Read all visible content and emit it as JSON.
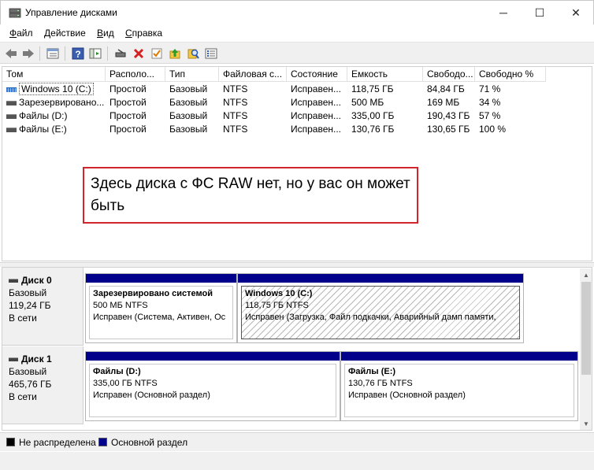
{
  "window": {
    "title": "Управление дисками",
    "minimize_glyph": "─",
    "maximize_glyph": "☐",
    "close_glyph": "✕"
  },
  "menu": {
    "items": [
      {
        "label": "Файл",
        "underline": "Ф",
        "rest": "айл"
      },
      {
        "label": "Действие",
        "underline": "Д",
        "rest": "ействие"
      },
      {
        "label": "Вид",
        "underline": "В",
        "rest": "ид"
      },
      {
        "label": "Справка",
        "underline": "С",
        "rest": "правка"
      }
    ]
  },
  "toolbar": {
    "buttons": [
      "back-arrow-icon",
      "forward-arrow-icon",
      "properties-list-icon",
      "help-icon",
      "console-tree-icon",
      "connect-drive-icon",
      "delete-icon",
      "check-icon",
      "up-folder-icon",
      "search-icon",
      "properties-icon"
    ]
  },
  "volumes": {
    "columns": [
      "Том",
      "Располо...",
      "Тип",
      "Файловая с...",
      "Состояние",
      "Емкость",
      "Свободо...",
      "Свободно %"
    ],
    "rows": [
      {
        "name": "Windows 10 (C:)",
        "layout": "Простой",
        "type": "Базовый",
        "fs": "NTFS",
        "status": "Исправен...",
        "capacity": "118,75 ГБ",
        "free": "84,84 ГБ",
        "free_pct": "71 %",
        "selected": true
      },
      {
        "name": "Зарезервировано...",
        "layout": "Простой",
        "type": "Базовый",
        "fs": "NTFS",
        "status": "Исправен...",
        "capacity": "500 МБ",
        "free": "169 МБ",
        "free_pct": "34 %",
        "selected": false
      },
      {
        "name": "Файлы (D:)",
        "layout": "Простой",
        "type": "Базовый",
        "fs": "NTFS",
        "status": "Исправен...",
        "capacity": "335,00 ГБ",
        "free": "190,43 ГБ",
        "free_pct": "57 %",
        "selected": false
      },
      {
        "name": "Файлы (E:)",
        "layout": "Простой",
        "type": "Базовый",
        "fs": "NTFS",
        "status": "Исправен...",
        "capacity": "130,76 ГБ",
        "free": "130,65 ГБ",
        "free_pct": "100 %",
        "selected": false
      }
    ]
  },
  "annotation": {
    "text": "Здесь диска с ФС RAW нет, но у вас он может быть",
    "border_color": "#d1252b"
  },
  "disks": [
    {
      "name": "Диск 0",
      "type": "Базовый",
      "size": "119,24 ГБ",
      "status": "В сети",
      "partitions": [
        {
          "name": "Зарезервировано системой",
          "size_fs": "500 МБ NTFS",
          "status": "Исправен (Система, Активен, Ос"
        },
        {
          "name": "Windows 10  (C:)",
          "size_fs": "118,75 ГБ NTFS",
          "status": "Исправен (Загрузка, Файл подкачки, Аварийный дамп памяти,"
        }
      ]
    },
    {
      "name": "Диск 1",
      "type": "Базовый",
      "size": "465,76 ГБ",
      "status": "В сети",
      "partitions": [
        {
          "name": "Файлы  (D:)",
          "size_fs": "335,00 ГБ NTFS",
          "status": "Исправен (Основной раздел)"
        },
        {
          "name": "Файлы  (E:)",
          "size_fs": "130,76 ГБ NTFS",
          "status": "Исправен (Основной раздел)"
        }
      ]
    }
  ],
  "legend": {
    "items": [
      {
        "label": "Не распределена",
        "color": "#000000"
      },
      {
        "label": "Основной раздел",
        "color": "#00008b"
      }
    ]
  },
  "colors": {
    "primary_partition": "#00008b",
    "unallocated": "#000000",
    "selection_accent": "#3a7bd5"
  }
}
